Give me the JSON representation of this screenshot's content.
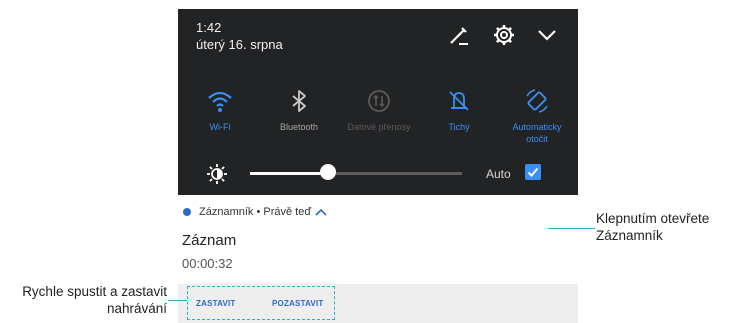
{
  "status": {
    "time": "1:42",
    "date": "úterý 16. srpna",
    "icons": [
      "edit-icon",
      "gear-icon",
      "chevron-down-icon"
    ]
  },
  "toggles": [
    {
      "label": "Wi-Fi",
      "state": "on",
      "icon": "wifi-icon"
    },
    {
      "label": "Bluetooth",
      "state": "off",
      "icon": "bluetooth-icon"
    },
    {
      "label": "Datové přenosy",
      "state": "disabled",
      "icon": "mobile-data-icon"
    },
    {
      "label": "Tichý",
      "state": "on",
      "icon": "silent-icon"
    },
    {
      "label": "Automaticky otočit",
      "state": "on",
      "icon": "auto-rotate-icon"
    }
  ],
  "brightness": {
    "level": 0.37,
    "auto_label": "Auto",
    "auto_checked": true
  },
  "notification": {
    "app_line": "Záznamník • Právě teď",
    "title": "Záznam",
    "timer": "00:00:32",
    "actions": [
      "ZASTAVIT",
      "POZASTAVIT"
    ]
  },
  "callouts": {
    "right": "Klepnutím otevřete Záznamník",
    "left": "Rychle spustit a zastavit nahrávání"
  },
  "colors": {
    "panel_bg": "#222325",
    "accent": "#3a8ff2",
    "callout_line": "#2ab1c7",
    "action_text": "#2d6ac8"
  }
}
